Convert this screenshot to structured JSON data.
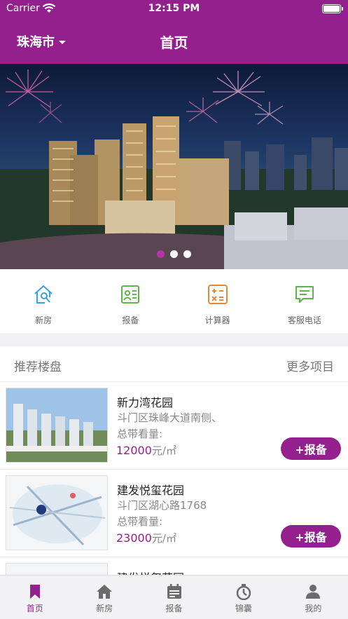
{
  "status": {
    "carrier": "Carrier",
    "time": "12:15 PM"
  },
  "nav": {
    "city": "珠海市",
    "title": "首页"
  },
  "banner": {
    "dots": [
      true,
      false,
      false
    ]
  },
  "quick_menu": [
    {
      "label": "新房",
      "icon": "house-search-icon",
      "color": "#3aa0d8"
    },
    {
      "label": "报备",
      "icon": "report-card-icon",
      "color": "#5fb54a"
    },
    {
      "label": "计算器",
      "icon": "calculator-icon",
      "color": "#e6883a"
    },
    {
      "label": "客服电话",
      "icon": "chat-bubble-icon",
      "color": "#5fb54a"
    }
  ],
  "section": {
    "title": "推荐楼盘",
    "more": "更多项目"
  },
  "listings": [
    {
      "name": "新力湾花园",
      "address": "斗门区珠峰大道南侧、",
      "views": "总带看量:",
      "price": "12000",
      "unit": "元/㎡",
      "button": "+报备"
    },
    {
      "name": "建发悦玺花园",
      "address": "斗门区湖心路1768",
      "views": "总带看量:",
      "price": "23000",
      "unit": "元/㎡",
      "button": "+报备"
    },
    {
      "name": "建发悦玺花园",
      "address": "",
      "views": "",
      "price": "",
      "unit": "",
      "button": ""
    }
  ],
  "tabbar": [
    {
      "label": "首页",
      "icon": "bookmark-icon",
      "active": true
    },
    {
      "label": "新房",
      "icon": "home-icon",
      "active": false
    },
    {
      "label": "报备",
      "icon": "calendar-icon",
      "active": false
    },
    {
      "label": "锦囊",
      "icon": "stopwatch-icon",
      "active": false
    },
    {
      "label": "我的",
      "icon": "person-icon",
      "active": false
    }
  ],
  "colors": {
    "brand": "#93208c",
    "background": "#f2f2f4"
  }
}
